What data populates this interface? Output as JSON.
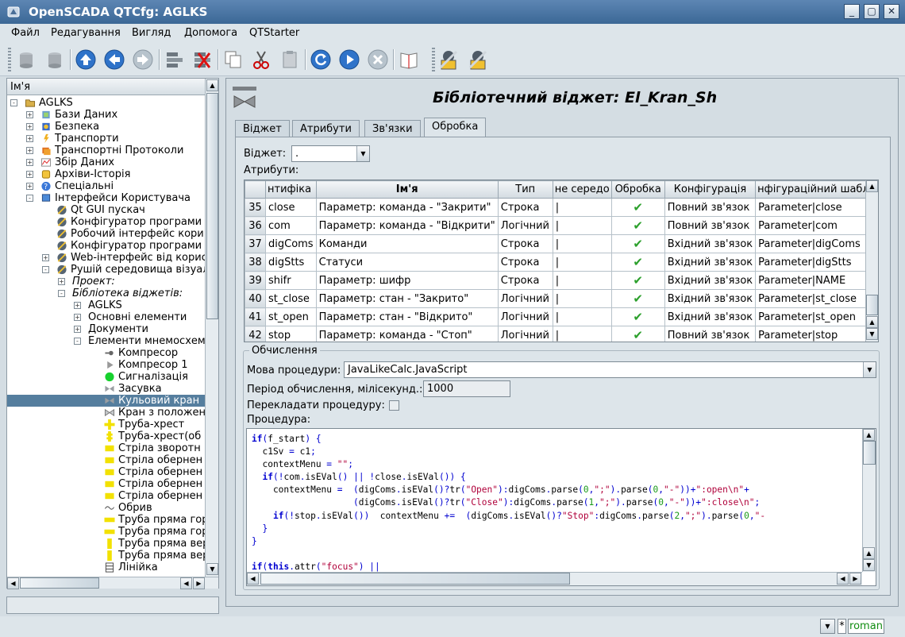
{
  "window": {
    "title": "OpenSCADA QTCfg: AGLKS",
    "buttons": [
      "_",
      "▢",
      "✕"
    ]
  },
  "menu": [
    "Файл",
    "Редагування",
    "Вигляд",
    "Допомога",
    "QTStarter"
  ],
  "toolbar": {
    "icons": [
      "db-load-icon",
      "db-save-icon",
      "up-icon",
      "back-icon",
      "forward-icon",
      "add-item-icon",
      "delete-item-icon",
      "copy-icon",
      "cut-icon",
      "paste-icon",
      "refresh-icon",
      "start-icon",
      "stop-icon",
      "help-icon",
      "qt-cfg-icon",
      "qt-cfg2-icon"
    ]
  },
  "tree": {
    "header": "Ім'я",
    "items": [
      {
        "label": "AGLKS",
        "lvl": 0,
        "exp": "-",
        "icon": "folder"
      },
      {
        "label": "Бази Даних",
        "lvl": 1,
        "exp": "+",
        "icon": "db"
      },
      {
        "label": "Безпека",
        "lvl": 1,
        "exp": "+",
        "icon": "security"
      },
      {
        "label": "Транспорти",
        "lvl": 1,
        "exp": "+",
        "icon": "transport"
      },
      {
        "label": "Транспортні Протоколи",
        "lvl": 1,
        "exp": "+",
        "icon": "protocol"
      },
      {
        "label": "Збір Даних",
        "lvl": 1,
        "exp": "+",
        "icon": "daq"
      },
      {
        "label": "Архіви-Історія",
        "lvl": 1,
        "exp": "+",
        "icon": "archive"
      },
      {
        "label": "Спеціальні",
        "lvl": 1,
        "exp": "+",
        "icon": "special"
      },
      {
        "label": "Інтерфейси Користувача",
        "lvl": 1,
        "exp": "-",
        "icon": "ui"
      },
      {
        "label": "Qt GUI пускач",
        "lvl": 2,
        "exp": "",
        "icon": "gui"
      },
      {
        "label": "Конфігуратор програми",
        "lvl": 2,
        "exp": "",
        "icon": "gui"
      },
      {
        "label": "Робочий інтерфейс кори",
        "lvl": 2,
        "exp": "",
        "icon": "gui"
      },
      {
        "label": "Конфігуратор програми",
        "lvl": 2,
        "exp": "",
        "icon": "gui"
      },
      {
        "label": "Web-інтерфейс від корис",
        "lvl": 2,
        "exp": "+",
        "icon": "gui"
      },
      {
        "label": "Рушій середовища візуал",
        "lvl": 2,
        "exp": "-",
        "icon": "gui"
      },
      {
        "label": "Проект:",
        "lvl": 3,
        "exp": "+",
        "icon": "",
        "italic": true
      },
      {
        "label": "Бібліотека віджетів:",
        "lvl": 3,
        "exp": "-",
        "icon": "",
        "italic": true
      },
      {
        "label": "AGLKS",
        "lvl": 4,
        "exp": "+",
        "icon": ""
      },
      {
        "label": "Основні елементи",
        "lvl": 4,
        "exp": "+",
        "icon": ""
      },
      {
        "label": "Документи",
        "lvl": 4,
        "exp": "+",
        "icon": ""
      },
      {
        "label": "Елементи мнемосхеми",
        "lvl": 4,
        "exp": "-",
        "icon": ""
      },
      {
        "label": "Компресор",
        "lvl": 5,
        "exp": "",
        "icon": "compressor"
      },
      {
        "label": "Компресор 1",
        "lvl": 5,
        "exp": "",
        "icon": "compressor1"
      },
      {
        "label": "Сигналізація",
        "lvl": 5,
        "exp": "",
        "icon": "signal"
      },
      {
        "label": "Засувка",
        "lvl": 5,
        "exp": "",
        "icon": "valve"
      },
      {
        "label": "Кульовий кран",
        "lvl": 5,
        "exp": "",
        "icon": "valve",
        "sel": true
      },
      {
        "label": "Кран з положен",
        "lvl": 5,
        "exp": "",
        "icon": "valve2"
      },
      {
        "label": "Труба-хрест",
        "lvl": 5,
        "exp": "",
        "icon": "cross"
      },
      {
        "label": "Труба-хрест(об",
        "lvl": 5,
        "exp": "",
        "icon": "cross2"
      },
      {
        "label": "Стріла зворотн",
        "lvl": 5,
        "exp": "",
        "icon": "yellow"
      },
      {
        "label": "Стріла обернен",
        "lvl": 5,
        "exp": "",
        "icon": "yellow"
      },
      {
        "label": "Стріла обернен",
        "lvl": 5,
        "exp": "",
        "icon": "yellow"
      },
      {
        "label": "Стріла обернен",
        "lvl": 5,
        "exp": "",
        "icon": "yellow"
      },
      {
        "label": "Стріла обернен",
        "lvl": 5,
        "exp": "",
        "icon": "yellow"
      },
      {
        "label": "Обрив",
        "lvl": 5,
        "exp": "",
        "icon": "break"
      },
      {
        "label": "Труба пряма гор",
        "lvl": 5,
        "exp": "",
        "icon": "pipeh"
      },
      {
        "label": "Труба пряма гор",
        "lvl": 5,
        "exp": "",
        "icon": "pipeh"
      },
      {
        "label": "Труба пряма вер",
        "lvl": 5,
        "exp": "",
        "icon": "pipev"
      },
      {
        "label": "Труба пряма вер",
        "lvl": 5,
        "exp": "",
        "icon": "pipev"
      },
      {
        "label": "Лінійка",
        "lvl": 5,
        "exp": "",
        "icon": "ruler"
      }
    ]
  },
  "page": {
    "title": "Бібліотечний віджет: El_Kran_Sh"
  },
  "tabs": [
    {
      "label": "Віджет"
    },
    {
      "label": "Атрибути"
    },
    {
      "label": "Зв'язки"
    },
    {
      "label": "Обробка",
      "active": true
    }
  ],
  "proc": {
    "widget_label": "Віджет:",
    "widget_value": ".",
    "attrs_label": "Атрибути:",
    "columns": [
      "нтифіка",
      "Ім'я",
      "Тип",
      "не середо",
      "Обробка",
      "Конфігурація",
      "нфігураційний шабл"
    ],
    "rows": [
      {
        "n": "35",
        "id": "close",
        "name": "Параметр: команда - \"Закрити\"",
        "type": "Строка",
        "wm": "|",
        "proc": "✔",
        "cfg": "Повний зв'язок",
        "tmpl": "Parameter|close"
      },
      {
        "n": "36",
        "id": "com",
        "name": "Параметр: команда - \"Відкрити\"",
        "type": "Логічний",
        "wm": "|",
        "proc": "✔",
        "cfg": "Повний зв'язок",
        "tmpl": "Parameter|com"
      },
      {
        "n": "37",
        "id": "digComs",
        "name": "Команди",
        "type": "Строка",
        "wm": "|",
        "proc": "✔",
        "cfg": "Вхідний зв'язок",
        "tmpl": "Parameter|digComs"
      },
      {
        "n": "38",
        "id": "digStts",
        "name": "Статуси",
        "type": "Строка",
        "wm": "|",
        "proc": "✔",
        "cfg": "Вхідний зв'язок",
        "tmpl": "Parameter|digStts"
      },
      {
        "n": "39",
        "id": "shifr",
        "name": "Параметр: шифр",
        "type": "Строка",
        "wm": "|",
        "proc": "✔",
        "cfg": "Вхідний зв'язок",
        "tmpl": "Parameter|NAME"
      },
      {
        "n": "40",
        "id": "st_close",
        "name": "Параметр: стан - \"Закрито\"",
        "type": "Логічний",
        "wm": "|",
        "proc": "✔",
        "cfg": "Вхідний зв'язок",
        "tmpl": "Parameter|st_close"
      },
      {
        "n": "41",
        "id": "st_open",
        "name": "Параметр: стан - \"Відкрито\"",
        "type": "Логічний",
        "wm": "|",
        "proc": "✔",
        "cfg": "Вхідний зв'язок",
        "tmpl": "Parameter|st_open"
      },
      {
        "n": "42",
        "id": "stop",
        "name": "Параметр: команда - \"Стоп\"",
        "type": "Логічний",
        "wm": "|",
        "proc": "✔",
        "cfg": "Повний зв'язок",
        "tmpl": "Parameter|stop"
      }
    ],
    "calc_legend": "Обчислення",
    "lang_label": "Мова процедури:",
    "lang_value": "JavaLikeCalc.JavaScript",
    "period_label": "Період обчислення, мілісекунд.:",
    "period_value": "1000",
    "translate_label": "Перекладати процедуру:",
    "proc_label": "Процедура:",
    "code": [
      "if(f_start) {",
      "  c1Sv = c1;",
      "  contextMenu = \"\";",
      "  if(!com.isEVal() || !close.isEVal()) {",
      "    contextMenu =  (digComs.isEVal()?tr(\"Open\"):digComs.parse(0,\";\").parse(0,\"-\"))+\":open\\n\"+",
      "                   (digComs.isEVal()?tr(\"Close\"):digComs.parse(1,\";\").parse(0,\"-\"))+\":close\\n\";",
      "    if(!stop.isEVal())  contextMenu +=  (digComs.isEVal()?\"Stop\":digComs.parse(2,\";\").parse(0,\"-",
      "  }",
      "}",
      "",
      "if(this.attr(\"focus\") ||"
    ]
  },
  "status": {
    "lang": "roman",
    "star": "*"
  }
}
